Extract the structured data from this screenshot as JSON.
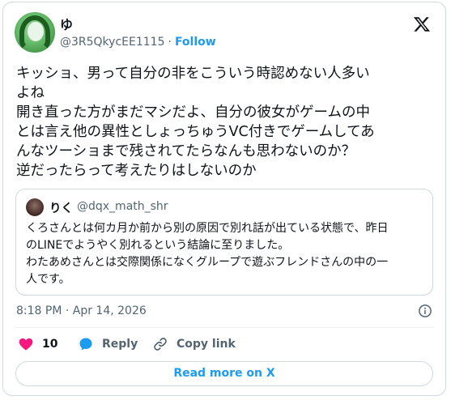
{
  "tweet": {
    "author_name": "ゆ",
    "author_handle": "@3R5QkycEE1115",
    "separator": "·",
    "follow_label": "Follow",
    "text_lines": [
      "キッショ、男って自分の非をこういう時認めない人多い",
      "よね",
      "開き直った方がまだマシだよ、自分の彼女がゲームの中",
      "とは言え他の異性としょっちゅうVC付きでゲームしてあ",
      "んなツーショまで残されてたらなんも思わないのか？",
      "逆だったらって考えたりはしないのか"
    ],
    "timestamp": "8:18 PM · Apr 14, 2026"
  },
  "quote": {
    "author_name": "りく",
    "author_handle": "@dqx_math_shr",
    "text_lines": [
      "くろさんとは何カ月か前から別の原因で別れ話が出ている状態で、昨日",
      "のLINEでようやく別れるという結論に至りました。",
      "わたあめさんとは交際関係になくグループで遊ぶフレンドさんの中の一",
      "人です。"
    ]
  },
  "actions": {
    "like_count": "10",
    "reply_label": "Reply",
    "copy_label": "Copy link"
  },
  "read_more_label": "Read more on X",
  "colors": {
    "accent": "#1d9bf0",
    "like": "#f91880",
    "text": "#0f1419",
    "secondary": "#536471",
    "border": "#cfd9de"
  },
  "icons": [
    "x-logo-icon",
    "info-icon",
    "heart-icon",
    "reply-bubble-icon",
    "link-icon"
  ]
}
